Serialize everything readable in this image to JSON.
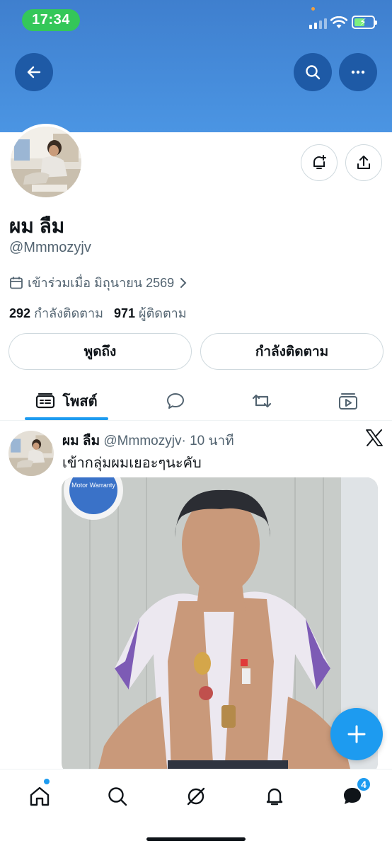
{
  "status_bar": {
    "time": "17:34"
  },
  "profile": {
    "display_name": "ผม ลืม",
    "handle": "@Mmmozyjv",
    "joined": "เข้าร่วมเมื่อ มิถุนายน 2569",
    "following_count": "292",
    "following_label": "กำลังติดตาม",
    "followers_count": "971",
    "followers_label": "ผู้ติดตาม"
  },
  "actions": {
    "mention_label": "พูดถึง",
    "following_button_label": "กำลังติดตาม"
  },
  "tabs": [
    {
      "label": "โพสต์",
      "icon": "posts-icon",
      "active": true
    },
    {
      "label": "",
      "icon": "replies-icon"
    },
    {
      "label": "",
      "icon": "retweet-icon"
    },
    {
      "label": "",
      "icon": "media-icon"
    }
  ],
  "post": {
    "author": "ผม ลืม",
    "handle": "@Mmmozyjv",
    "separator": "·",
    "time": "10 นาที",
    "text": "เข้ากลุ่มผมเยอะๆนะคับ",
    "image_sticker_text": "Motor Warranty"
  },
  "bottom_nav": {
    "items": [
      "home-icon",
      "search-icon",
      "grok-icon",
      "notifications-icon",
      "messages-icon"
    ],
    "messages_badge": "4"
  },
  "colors": {
    "accent": "#1d9bf0",
    "banner": "#4b95e3",
    "status_green": "#34c759"
  }
}
